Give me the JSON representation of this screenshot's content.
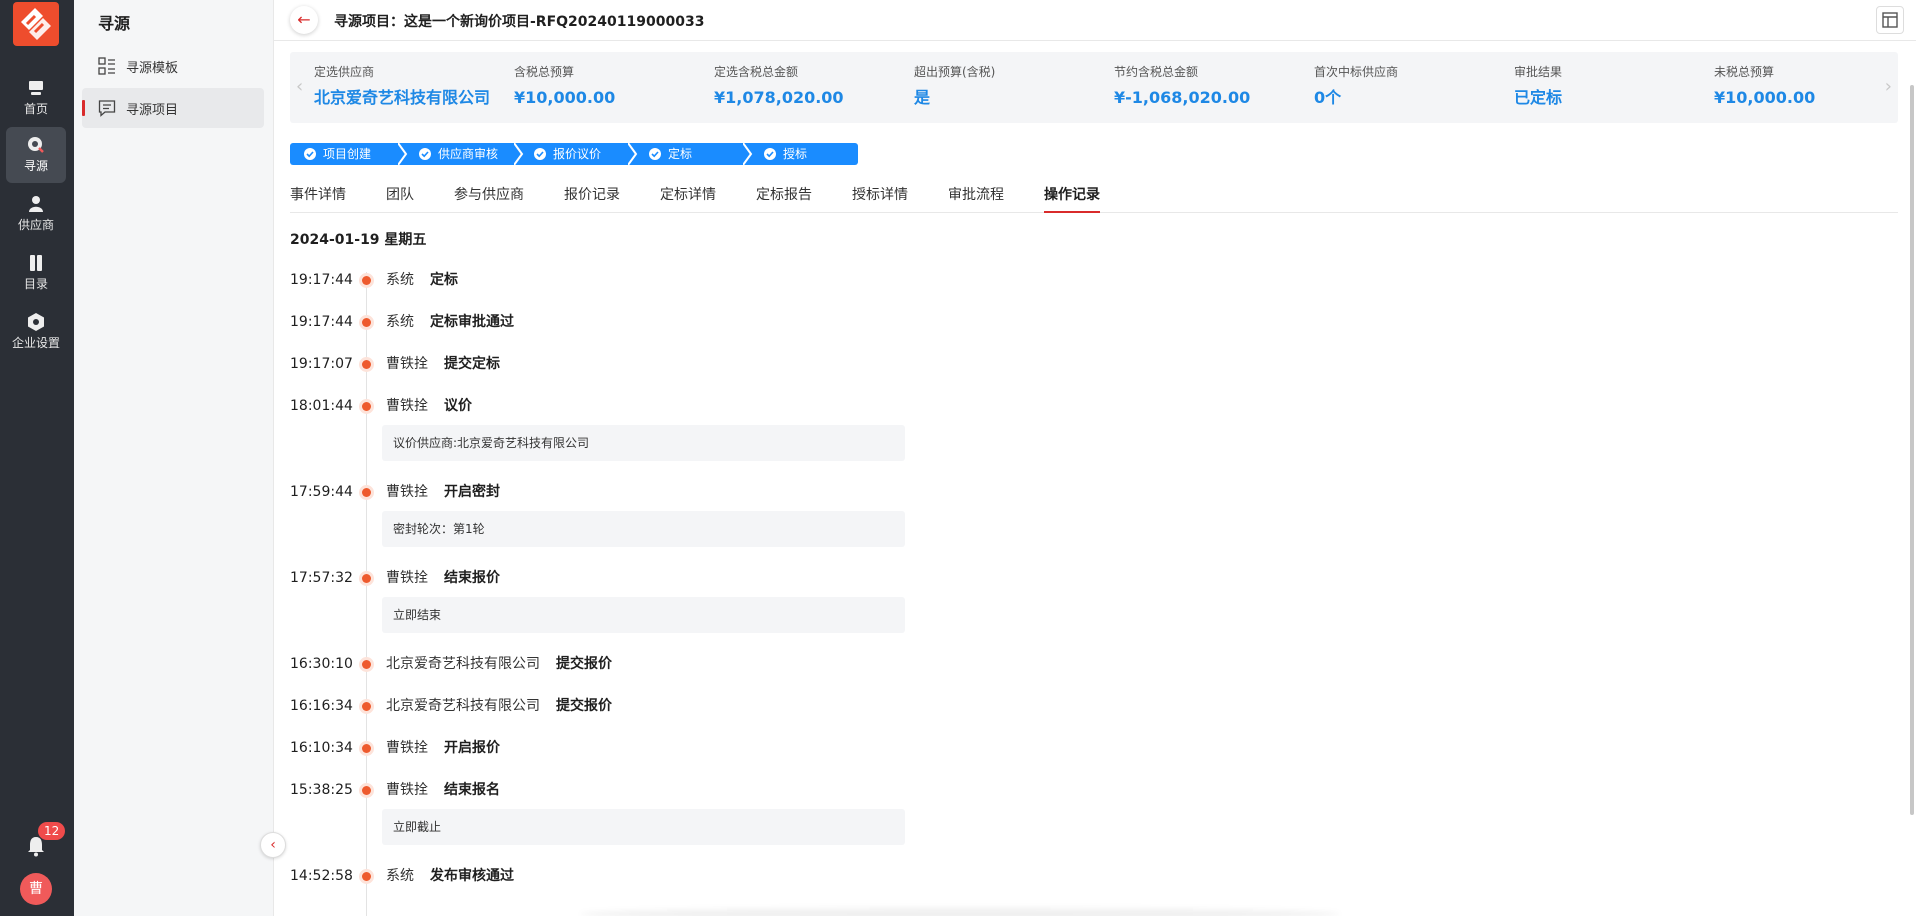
{
  "nav": {
    "items": [
      {
        "label": "首页",
        "icon": "home-icon"
      },
      {
        "label": "寻源",
        "icon": "sourcing-icon"
      },
      {
        "label": "供应商",
        "icon": "supplier-icon"
      },
      {
        "label": "目录",
        "icon": "catalog-icon"
      },
      {
        "label": "企业设置",
        "icon": "settings-icon"
      }
    ],
    "notification_count": "12",
    "avatar_text": "曹"
  },
  "subnav": {
    "title": "寻源",
    "items": [
      {
        "label": "寻源模板",
        "icon": "template-icon"
      },
      {
        "label": "寻源项目",
        "icon": "project-icon"
      }
    ]
  },
  "header": {
    "title": "寻源项目：这是一个新询价项目-RFQ20240119000033"
  },
  "summary": [
    {
      "label": "定选供应商",
      "value": "北京爱奇艺科技有限公司"
    },
    {
      "label": "含税总预算",
      "value": "¥10,000.00"
    },
    {
      "label": "定选含税总金额",
      "value": "¥1,078,020.00"
    },
    {
      "label": "超出预算(含税)",
      "value": "是"
    },
    {
      "label": "节约含税总金额",
      "value": "¥-1,068,020.00"
    },
    {
      "label": "首次中标供应商",
      "value": "0个"
    },
    {
      "label": "审批结果",
      "value": "已定标"
    },
    {
      "label": "未税总预算",
      "value": "¥10,000.00"
    }
  ],
  "steps": [
    "项目创建",
    "供应商审核",
    "报价议价",
    "定标",
    "授标"
  ],
  "tabs": [
    "事件详情",
    "团队",
    "参与供应商",
    "报价记录",
    "定标详情",
    "定标报告",
    "授标详情",
    "审批流程",
    "操作记录"
  ],
  "timeline": {
    "date": "2024-01-19 星期五",
    "entries": [
      {
        "time": "19:17:44",
        "actor": "系统",
        "action": "定标"
      },
      {
        "time": "19:17:44",
        "actor": "系统",
        "action": "定标审批通过"
      },
      {
        "time": "19:17:07",
        "actor": "曹铁拴",
        "action": "提交定标"
      },
      {
        "time": "18:01:44",
        "actor": "曹铁拴",
        "action": "议价",
        "note": "议价供应商:北京爱奇艺科技有限公司"
      },
      {
        "time": "17:59:44",
        "actor": "曹铁拴",
        "action": "开启密封",
        "note": "密封轮次：第1轮"
      },
      {
        "time": "17:57:32",
        "actor": "曹铁拴",
        "action": "结束报价",
        "note": "立即结束"
      },
      {
        "time": "16:30:10",
        "actor": "北京爱奇艺科技有限公司",
        "action": "提交报价"
      },
      {
        "time": "16:16:34",
        "actor": "北京爱奇艺科技有限公司",
        "action": "提交报价"
      },
      {
        "time": "16:10:34",
        "actor": "曹铁拴",
        "action": "开启报价"
      },
      {
        "time": "15:38:25",
        "actor": "曹铁拴",
        "action": "结束报名",
        "note": "立即截止"
      },
      {
        "time": "14:52:58",
        "actor": "系统",
        "action": "发布审核通过"
      }
    ]
  },
  "colors": {
    "accent": "#d92b2b",
    "value_blue": "#1e88e5",
    "step_blue": "#1a8cff",
    "dot": "#ee5a2d"
  }
}
